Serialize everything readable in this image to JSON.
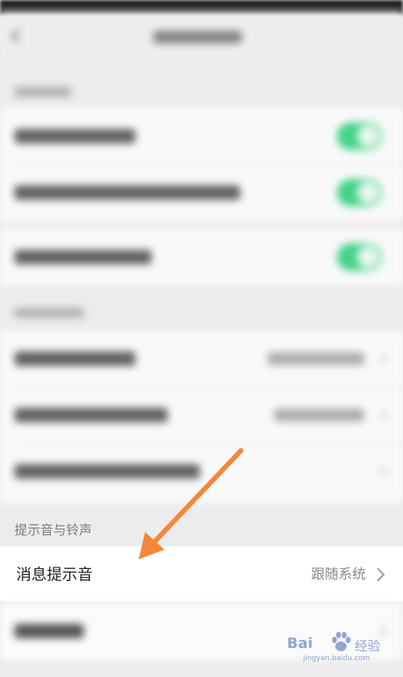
{
  "section": {
    "title": "提示音与铃声"
  },
  "ringtone": {
    "label": "消息提示音",
    "value": "跟随系统"
  },
  "watermark": {
    "left": "Bai",
    "right": "经验",
    "url": "jingyan.baidu.com"
  },
  "colors": {
    "toggle_on": "#35d07f",
    "arrow": "#f5873a",
    "watermark": "#3b5fb8"
  },
  "icons": {
    "back": "back-arrow-icon",
    "chevron": "chevron-right-icon",
    "paw": "baidu-paw-icon"
  }
}
